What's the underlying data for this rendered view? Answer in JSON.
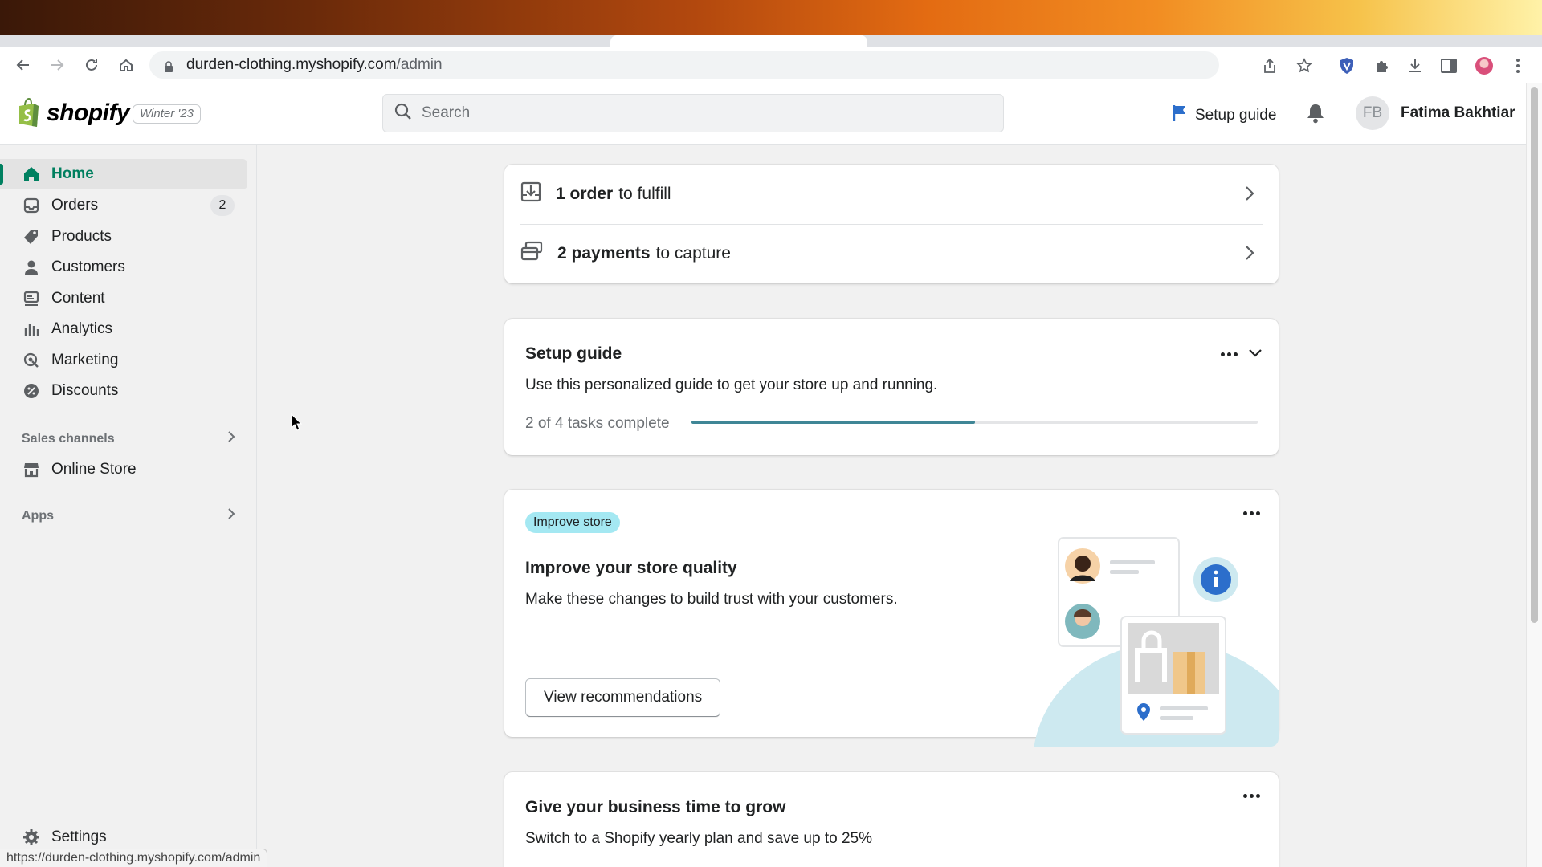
{
  "browser": {
    "url_host": "durden-clothing.myshopify.com",
    "url_path": "/admin",
    "status_url": "https://durden-clothing.myshopify.com/admin"
  },
  "topbar": {
    "brand": "shopify",
    "edition": "Winter '23",
    "search_placeholder": "Search",
    "setup_guide": "Setup guide",
    "user_initials": "FB",
    "user_name": "Fatima Bakhtiar"
  },
  "sidebar": {
    "items": [
      {
        "label": "Home",
        "icon": "home-icon"
      },
      {
        "label": "Orders",
        "icon": "orders-icon",
        "count": "2"
      },
      {
        "label": "Products",
        "icon": "tag-icon"
      },
      {
        "label": "Customers",
        "icon": "person-icon"
      },
      {
        "label": "Content",
        "icon": "content-icon"
      },
      {
        "label": "Analytics",
        "icon": "analytics-icon"
      },
      {
        "label": "Marketing",
        "icon": "marketing-icon"
      },
      {
        "label": "Discounts",
        "icon": "discount-icon"
      }
    ],
    "sales_channels": "Sales channels",
    "online_store": "Online Store",
    "apps": "Apps",
    "settings": "Settings"
  },
  "tasks": {
    "order_bold": "1 order",
    "order_rest": "to fulfill",
    "payments_bold": "2 payments",
    "payments_rest": "to capture"
  },
  "setup_guide": {
    "title": "Setup guide",
    "description": "Use this personalized guide to get your store up and running.",
    "progress_text": "2 of 4 tasks complete",
    "completed": 2,
    "total": 4
  },
  "improve": {
    "pill": "Improve store",
    "title": "Improve your store quality",
    "description": "Make these changes to build trust with your customers.",
    "button": "View recommendations"
  },
  "grow": {
    "title": "Give your business time to grow",
    "description": "Switch to a Shopify yearly plan and save up to 25%"
  },
  "colors": {
    "accent_green": "#008060",
    "progress": "#3f8696",
    "pill_bg": "#a4e8f2"
  }
}
